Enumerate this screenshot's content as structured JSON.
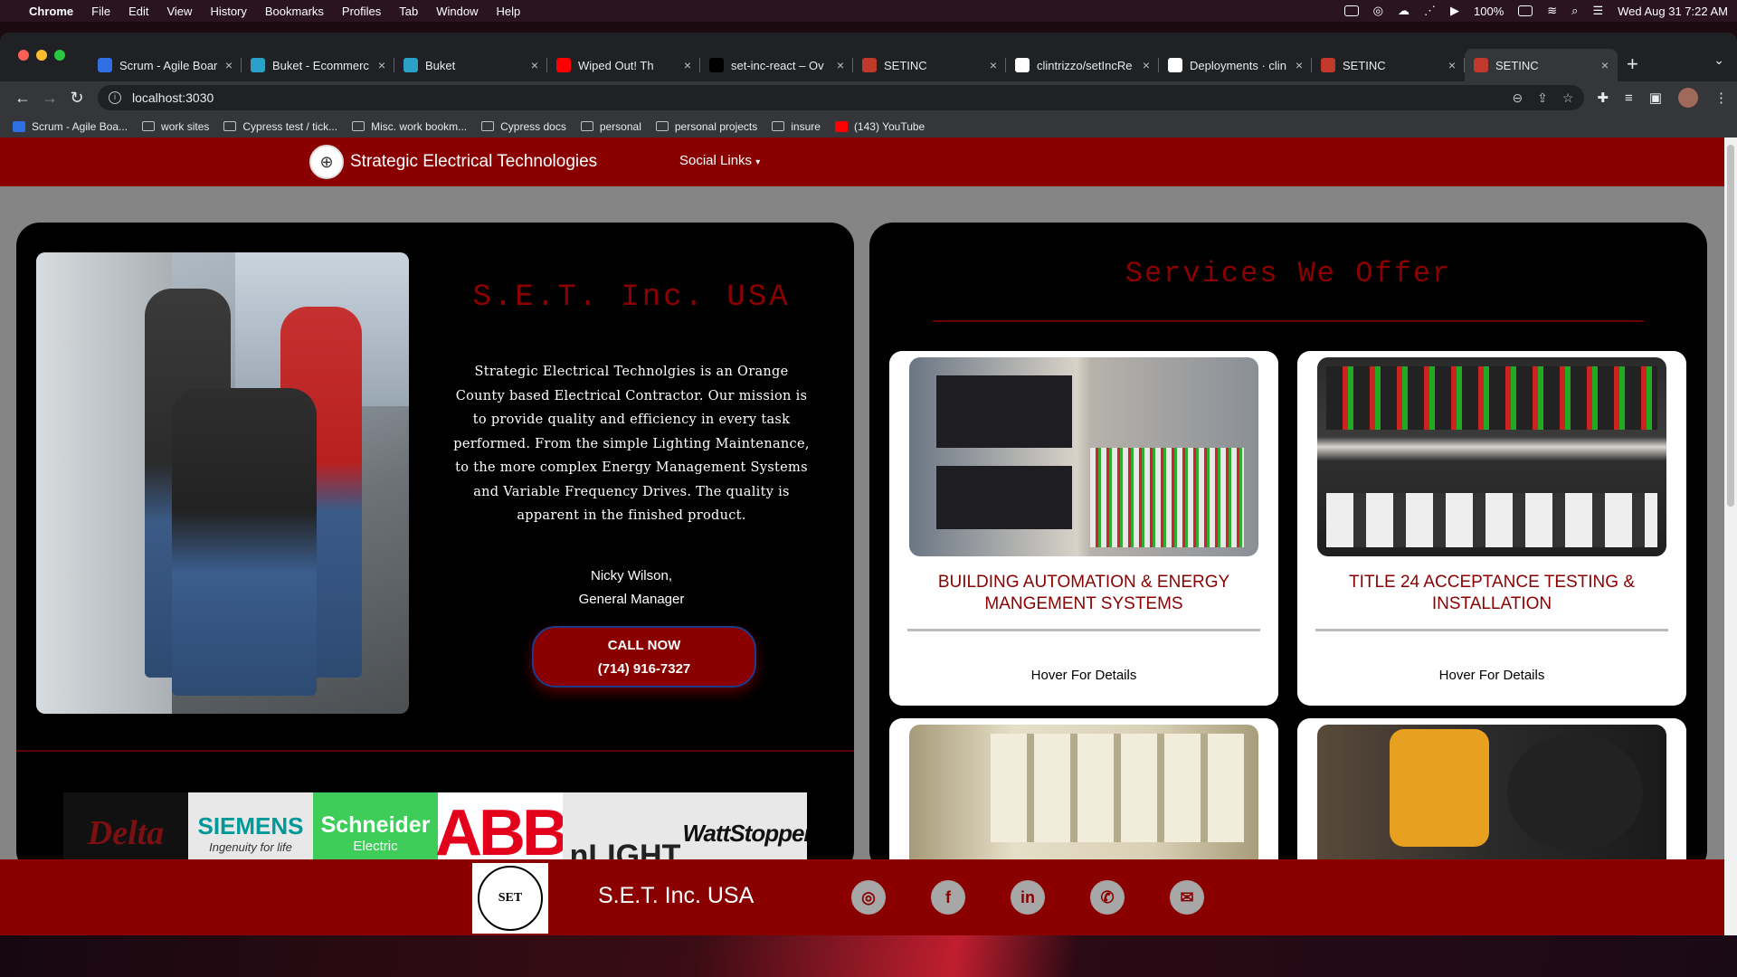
{
  "menubar": {
    "app": "Chrome",
    "items": [
      "File",
      "Edit",
      "View",
      "History",
      "Bookmarks",
      "Profiles",
      "Tab",
      "Window",
      "Help"
    ],
    "battery": "100%",
    "datetime": "Wed Aug 31  7:22 AM"
  },
  "browser": {
    "tabs": [
      {
        "label": "Scrum - Agile Boar",
        "color": "#2f6fe4"
      },
      {
        "label": "Buket - Ecommerc",
        "color": "#2aa0c8"
      },
      {
        "label": "Buket",
        "color": "#2aa0c8"
      },
      {
        "label": "Wiped Out! Th",
        "color": "#ff0000"
      },
      {
        "label": "set-inc-react – Ov",
        "color": "#000000"
      },
      {
        "label": "SETINC",
        "color": "#c0392b"
      },
      {
        "label": "clintrizzo/setIncRe",
        "color": "#ffffff"
      },
      {
        "label": "Deployments · clin",
        "color": "#ffffff"
      },
      {
        "label": "SETINC",
        "color": "#c0392b"
      },
      {
        "label": "SETINC",
        "color": "#c0392b"
      }
    ],
    "url": "localhost:3030",
    "bookmarks": [
      {
        "label": "Scrum - Agile Boa...",
        "kind": "site"
      },
      {
        "label": "work sites",
        "kind": "folder"
      },
      {
        "label": "Cypress test / tick...",
        "kind": "folder"
      },
      {
        "label": "Misc. work bookm...",
        "kind": "folder"
      },
      {
        "label": "Cypress docs",
        "kind": "folder"
      },
      {
        "label": "personal",
        "kind": "folder"
      },
      {
        "label": "personal projects",
        "kind": "folder"
      },
      {
        "label": "insure",
        "kind": "folder"
      },
      {
        "label": "(143) YouTube",
        "kind": "youtube"
      }
    ]
  },
  "site": {
    "brand_name": "Strategic Electrical Technologies",
    "social_links": "Social Links",
    "company_title": "S.E.T. Inc. USA",
    "description": "Strategic Electrical Technolgies is an Orange County based Electrical Contractor. Our mission is to provide quality and efficiency in every task performed. From the simple Lighting Maintenance, to the more complex Energy Management Systems and Variable Frequency Drives. The quality is apparent in the finished product.",
    "manager_name": "Nicky Wilson,",
    "manager_role": "General Manager",
    "call_label": "CALL NOW",
    "call_number": "(714) 916-7327",
    "partners": [
      "Delta",
      "SIEMENS",
      "Ingenuity for life",
      "Schneider",
      "Electric",
      "ABB",
      "nLIGHT",
      "WattStopper"
    ],
    "services_title": "Services We Offer",
    "services": [
      {
        "title": "BUILDING AUTOMATION & ENERGY MANGEMENT SYSTEMS",
        "hover": "Hover For Details"
      },
      {
        "title": "TITLE 24 ACCEPTANCE TESTING & INSTALLATION",
        "hover": "Hover For Details"
      },
      {
        "title": "",
        "hover": ""
      },
      {
        "title": "",
        "hover": ""
      }
    ],
    "footer_title": "S.E.T. Inc. USA",
    "footer_logo_text": "SET",
    "colors": {
      "brand_red": "#8a0000",
      "title_red": "#8b0000",
      "card_bg": "#000000"
    }
  }
}
